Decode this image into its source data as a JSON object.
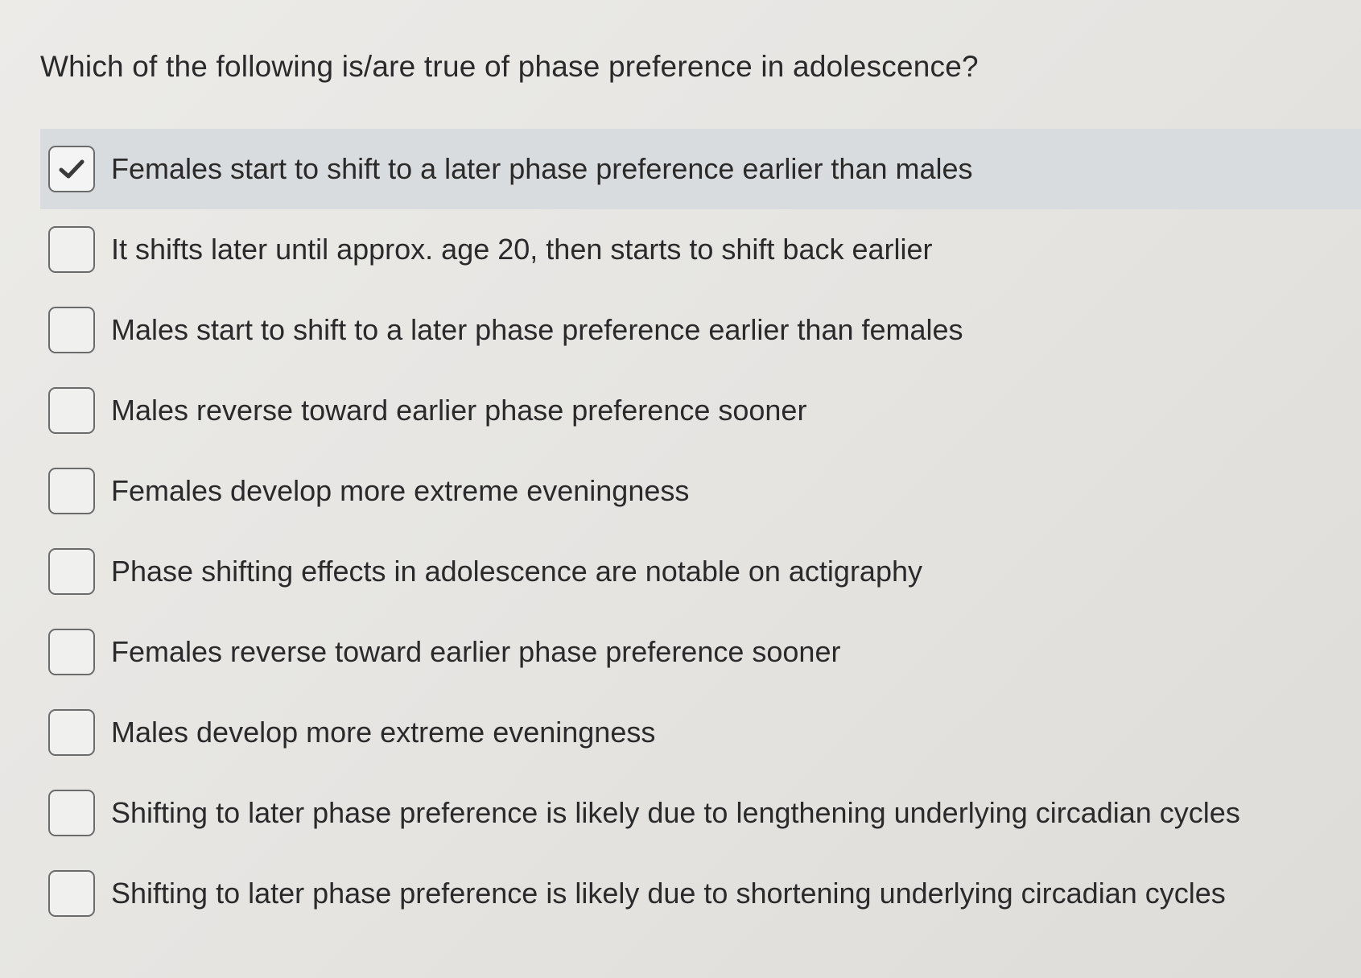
{
  "question": {
    "text": "Which of the following is/are true of phase preference in adolescence?"
  },
  "options": [
    {
      "label": "Females start to shift to a later phase preference earlier than males",
      "checked": true
    },
    {
      "label": "It shifts later until approx. age 20, then starts to shift back earlier",
      "checked": false
    },
    {
      "label": "Males start to shift to a later phase preference earlier than females",
      "checked": false
    },
    {
      "label": "Males reverse toward earlier phase preference sooner",
      "checked": false
    },
    {
      "label": "Females develop more extreme eveningness",
      "checked": false
    },
    {
      "label": "Phase shifting effects in adolescence are notable on actigraphy",
      "checked": false
    },
    {
      "label": "Females reverse toward earlier phase preference sooner",
      "checked": false
    },
    {
      "label": "Males develop more extreme eveningness",
      "checked": false
    },
    {
      "label": "Shifting to later phase preference is likely due to lengthening underlying circadian cycles",
      "checked": false
    },
    {
      "label": "Shifting to later phase preference is likely due to shortening underlying circadian cycles",
      "checked": false
    }
  ],
  "icons": {
    "checked": "checkmark-icon"
  },
  "colors": {
    "selected_row": "#d9dcde",
    "checkmark": "#3a3a3a"
  }
}
